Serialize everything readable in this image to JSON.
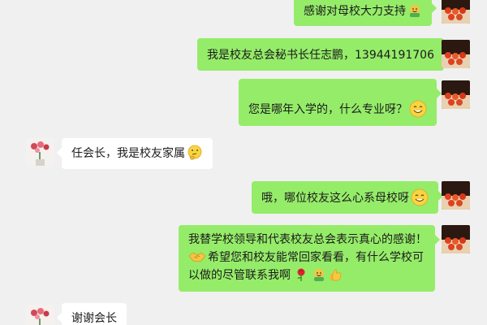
{
  "messages": [
    {
      "from": "self",
      "text": "感谢对母校大力支持",
      "emoji": [
        "hug-emoji"
      ]
    },
    {
      "from": "self",
      "text": "我是校友总会秘书长任志鹏，13944191706"
    },
    {
      "from": "self",
      "text": "您是哪年入学的，什么专业呀？",
      "emoji": [
        "smile-emoji"
      ]
    },
    {
      "from": "other",
      "text": "任会长，我是校友家属",
      "emoji": [
        "thinking-emoji"
      ]
    },
    {
      "from": "self",
      "text": "哦，哪位校友这么心系母校呀",
      "emoji": [
        "smile-emoji"
      ]
    },
    {
      "from": "self",
      "lines": [
        "我替学校领导和代表校友总会表示真心的感谢！",
        "希望您和校友能常回家看看，有什么学校可",
        "以做的尽管联系我啊"
      ],
      "emoji": [
        "handshake-emoji",
        "rose-emoji",
        "hug-emoji",
        "thumbs-up-emoji"
      ]
    },
    {
      "from": "other",
      "text": "谢谢会长"
    }
  ],
  "colors": {
    "background": "#f0f0f0",
    "self_bubble": "#95ec69",
    "other_bubble": "#ffffff"
  }
}
